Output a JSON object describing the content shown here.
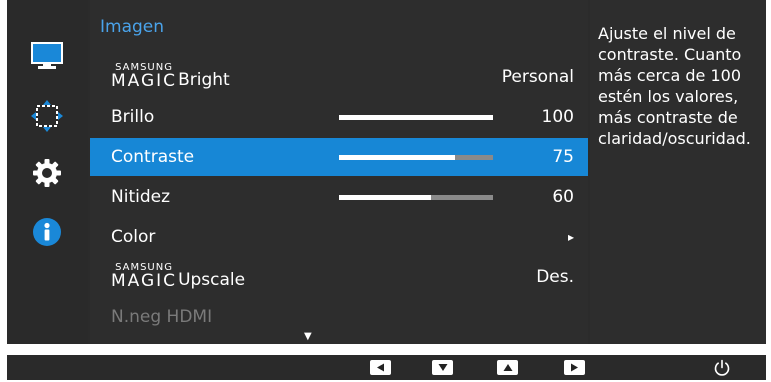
{
  "menu": {
    "title": "Imagen",
    "rows": [
      {
        "brand_small": "SAMSUNG",
        "brand_big": "MAGIC",
        "label": "Bright",
        "value": "Personal"
      },
      {
        "label": "Brillo",
        "value": "100",
        "level": 1.0
      },
      {
        "label": "Contraste",
        "value": "75",
        "level": 0.75,
        "selected": true
      },
      {
        "label": "Nitidez",
        "value": "60",
        "level": 0.6
      },
      {
        "label": "Color",
        "value": "▸"
      },
      {
        "brand_small": "SAMSUNG",
        "brand_big": "MAGIC",
        "label": "Upscale",
        "value": "Des."
      },
      {
        "label": "N.neg HDMI",
        "value": "",
        "disabled": true
      }
    ]
  },
  "help": {
    "text": "Ajuste el nivel de contraste. Cuanto más cerca de 100 estén los valores, más contraste de claridad/oscuridad."
  },
  "sidebar": {
    "icons": [
      "monitor-icon",
      "position-arrows-icon",
      "gear-icon",
      "info-icon"
    ],
    "active_color": "#1787d6"
  },
  "bottom": {
    "buttons": [
      "left-arrow-icon",
      "down-arrow-icon",
      "up-arrow-icon",
      "right-arrow-icon"
    ],
    "power": "power-icon"
  },
  "colors": {
    "accent": "#1787d6",
    "title": "#4aa3ea",
    "background": "#2d2d2d"
  }
}
